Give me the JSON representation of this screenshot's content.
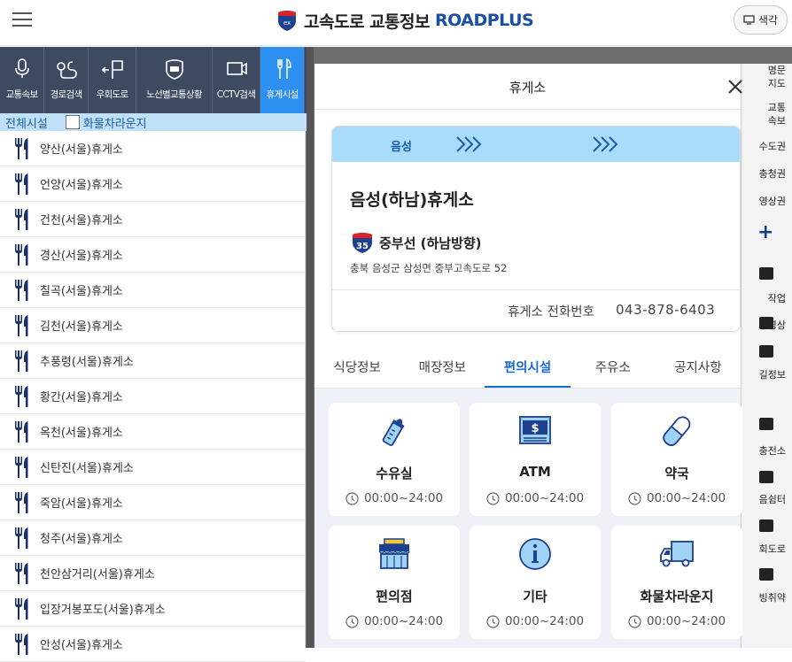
{
  "header": {
    "logo_text": "고속도로 교통정보",
    "logo_brand": "ROADPLUS",
    "color_button": "색각"
  },
  "left_tabs": [
    {
      "label": "교통속보",
      "icon": "microphone-icon"
    },
    {
      "label": "경로검색",
      "icon": "route-icon"
    },
    {
      "label": "우회도로",
      "icon": "detour-icon"
    },
    {
      "label": "노선별교통상황",
      "icon": "road-sign-icon"
    },
    {
      "label": "CCTV검색",
      "icon": "cctv-icon"
    },
    {
      "label": "휴게시설",
      "icon": "fork-knife-icon"
    }
  ],
  "filter": {
    "all_label": "전체시설",
    "truck_label": "화물차라운지"
  },
  "rest_areas": [
    "양산(서울)휴게소",
    "언양(서울)휴게소",
    "건천(서울)휴게소",
    "경산(서울)휴게소",
    "칠곡(서울)휴게소",
    "김천(서울)휴게소",
    "추풍령(서울)휴게소",
    "황간(서울)휴게소",
    "옥천(서울)휴게소",
    "신탄진(서울)휴게소",
    "죽암(서울)휴게소",
    "청주(서울)휴게소",
    "천안삼거리(서울)휴게소",
    "입장거봉포도(서울)휴게소",
    "안성(서울)휴게소"
  ],
  "right_strip": {
    "items": [
      "명문\n지도",
      "교통\n속보",
      "수도권",
      "충청권",
      "영상권"
    ],
    "tools": [
      "작업",
      "상영상",
      "길정보",
      "충전소",
      "음쉼터",
      "회도로",
      "빙취약"
    ]
  },
  "modal": {
    "title": "휴게소",
    "location": "음성",
    "name": "음성(하남)휴게소",
    "route_number": "35",
    "route_name": "중부선 (하남방향)",
    "address": "충북 음성군 삼성면 중부고속도로 52",
    "phone_label": "휴게소 전화번호",
    "phone": "043-878-6403",
    "tabs": [
      "식당정보",
      "매장정보",
      "편의시설",
      "주유소",
      "공지사항"
    ],
    "active_tab": "편의시설",
    "facilities": [
      {
        "name": "수유실",
        "time": "00:00~24:00",
        "icon": "baby-bottle-icon"
      },
      {
        "name": "ATM",
        "time": "00:00~24:00",
        "icon": "atm-icon"
      },
      {
        "name": "약국",
        "time": "00:00~24:00",
        "icon": "pill-icon"
      },
      {
        "name": "편의점",
        "time": "00:00~24:00",
        "icon": "store-icon"
      },
      {
        "name": "기타",
        "time": "00:00~24:00",
        "icon": "info-icon"
      },
      {
        "name": "화물차라운지",
        "time": "00:00~24:00",
        "icon": "truck-icon"
      }
    ]
  },
  "colors": {
    "nav_bg": "#3d4a60",
    "nav_active": "#2d8ff0",
    "brand": "#1a4fa3",
    "accent": "#1a6ad6",
    "card_band": "#a9dcfb"
  }
}
